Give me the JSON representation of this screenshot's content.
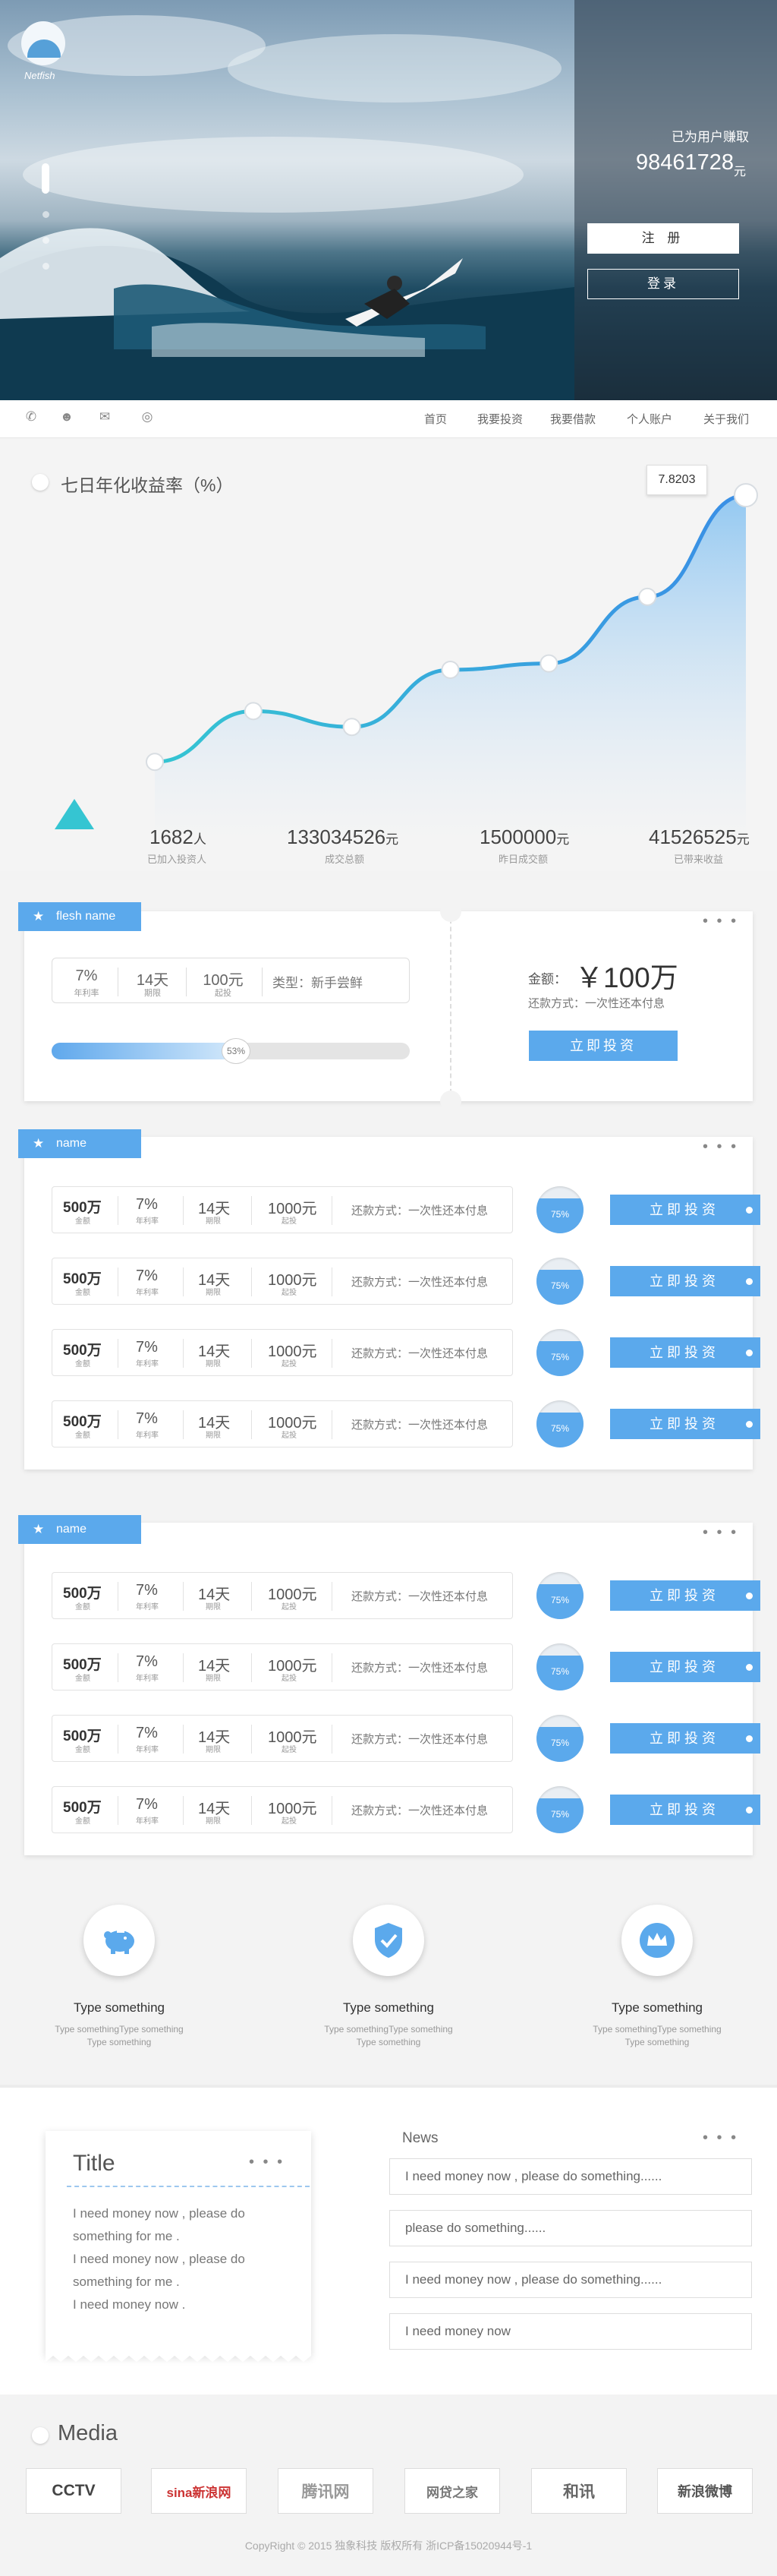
{
  "hero": {
    "logo_text": "Netfish",
    "earned_label": "已为用户赚取",
    "earned_value": "98461728",
    "earned_unit": "元",
    "register": "注 册",
    "login": "登录"
  },
  "nav": {
    "links": [
      "首页",
      "我要投资",
      "我要借款",
      "个人账户",
      "关于我们"
    ],
    "icons": [
      "phone-icon",
      "qq-icon",
      "wechat-icon",
      "weibo-icon"
    ]
  },
  "chart_data": {
    "type": "area",
    "title": "七日年化收益率（%）",
    "highlight_value": "7.8203",
    "points": [
      {
        "x": 1,
        "y": 1.0
      },
      {
        "x": 2,
        "y": 2.6
      },
      {
        "x": 3,
        "y": 2.1
      },
      {
        "x": 4,
        "y": 3.9
      },
      {
        "x": 5,
        "y": 4.1
      },
      {
        "x": 6,
        "y": 6.2
      },
      {
        "x": 7,
        "y": 9.4
      }
    ],
    "ylim": [
      0,
      10
    ],
    "xlim": [
      1,
      7
    ],
    "grid": false,
    "line_color": "#3aa8e0",
    "fill_color": "#8ec6f2"
  },
  "stats": [
    {
      "value": "1682",
      "unit": "人",
      "label": "已加入投资人"
    },
    {
      "value": "133034526",
      "unit": "元",
      "label": "成交总额"
    },
    {
      "value": "1500000",
      "unit": "元",
      "label": "昨日成交额"
    },
    {
      "value": "41526525",
      "unit": "元",
      "label": "已带来收益"
    }
  ],
  "flesh": {
    "tag": "flesh name",
    "more": "• • •",
    "rate": "7%",
    "rate_label": "年利率",
    "term": "14天",
    "term_label": "期限",
    "min": "100元",
    "min_label": "起投",
    "type": "类型：新手尝鲜",
    "progress_label": "53%",
    "progress_value": 0.53,
    "amount_label": "金额：",
    "amount": "￥100万",
    "repay": "还款方式：一次性还本付息",
    "invest": "立即投资"
  },
  "product_panels": [
    {
      "tag": "name",
      "more": "• • •",
      "rows": [
        {
          "amount": "500万",
          "amount_label": "金额",
          "rate": "7%",
          "rate_label": "年利率",
          "term": "14天",
          "term_label": "期限",
          "min": "1000元",
          "min_label": "起投",
          "repay": "还款方式：一次性还本付息",
          "progress": "75%",
          "invest": "立即投资"
        },
        {
          "amount": "500万",
          "amount_label": "金额",
          "rate": "7%",
          "rate_label": "年利率",
          "term": "14天",
          "term_label": "期限",
          "min": "1000元",
          "min_label": "起投",
          "repay": "还款方式：一次性还本付息",
          "progress": "75%",
          "invest": "立即投资"
        },
        {
          "amount": "500万",
          "amount_label": "金额",
          "rate": "7%",
          "rate_label": "年利率",
          "term": "14天",
          "term_label": "期限",
          "min": "1000元",
          "min_label": "起投",
          "repay": "还款方式：一次性还本付息",
          "progress": "75%",
          "invest": "立即投资"
        },
        {
          "amount": "500万",
          "amount_label": "金额",
          "rate": "7%",
          "rate_label": "年利率",
          "term": "14天",
          "term_label": "期限",
          "min": "1000元",
          "min_label": "起投",
          "repay": "还款方式：一次性还本付息",
          "progress": "75%",
          "invest": "立即投资"
        }
      ]
    },
    {
      "tag": "name",
      "more": "• • •",
      "rows": [
        {
          "amount": "500万",
          "amount_label": "金额",
          "rate": "7%",
          "rate_label": "年利率",
          "term": "14天",
          "term_label": "期限",
          "min": "1000元",
          "min_label": "起投",
          "repay": "还款方式：一次性还本付息",
          "progress": "75%",
          "invest": "立即投资"
        },
        {
          "amount": "500万",
          "amount_label": "金额",
          "rate": "7%",
          "rate_label": "年利率",
          "term": "14天",
          "term_label": "期限",
          "min": "1000元",
          "min_label": "起投",
          "repay": "还款方式：一次性还本付息",
          "progress": "75%",
          "invest": "立即投资"
        },
        {
          "amount": "500万",
          "amount_label": "金额",
          "rate": "7%",
          "rate_label": "年利率",
          "term": "14天",
          "term_label": "期限",
          "min": "1000元",
          "min_label": "起投",
          "repay": "还款方式：一次性还本付息",
          "progress": "75%",
          "invest": "立即投资"
        },
        {
          "amount": "500万",
          "amount_label": "金额",
          "rate": "7%",
          "rate_label": "年利率",
          "term": "14天",
          "term_label": "期限",
          "min": "1000元",
          "min_label": "起投",
          "repay": "还款方式：一次性还本付息",
          "progress": "75%",
          "invest": "立即投资"
        }
      ]
    }
  ],
  "features": [
    {
      "icon": "piggy-bank-icon",
      "title": "Type something",
      "desc": "Type somethingType something",
      "desc2": "Type something"
    },
    {
      "icon": "shield-check-icon",
      "title": "Type something",
      "desc": "Type somethingType something",
      "desc2": "Type something"
    },
    {
      "icon": "crown-icon",
      "title": "Type something",
      "desc": "Type somethingType something",
      "desc2": "Type something"
    }
  ],
  "note": {
    "title": "Title",
    "more": "• • •",
    "lines": [
      "I need money now , please do",
      "something for me .",
      "I need money now , please do",
      "something for me .",
      "I need money now ."
    ]
  },
  "news": {
    "title": "News",
    "more": "• • •",
    "items": [
      "I need money now , please do something......",
      "please do something......",
      "I need money now , please do something......",
      "I need money now"
    ]
  },
  "media": {
    "title": "Media",
    "logos": [
      "CCTV",
      "sina新浪网",
      "腾讯网",
      "网贷之家",
      "和讯",
      "新浪微博"
    ]
  },
  "footer": {
    "copyright": "CopyRight © 2015 独象科技 版权所有 浙ICP备15020944号-1"
  },
  "colors": {
    "accent": "#5ba9ec",
    "chart_line": "#3aa8e0",
    "triangle": "#35c5d2"
  }
}
